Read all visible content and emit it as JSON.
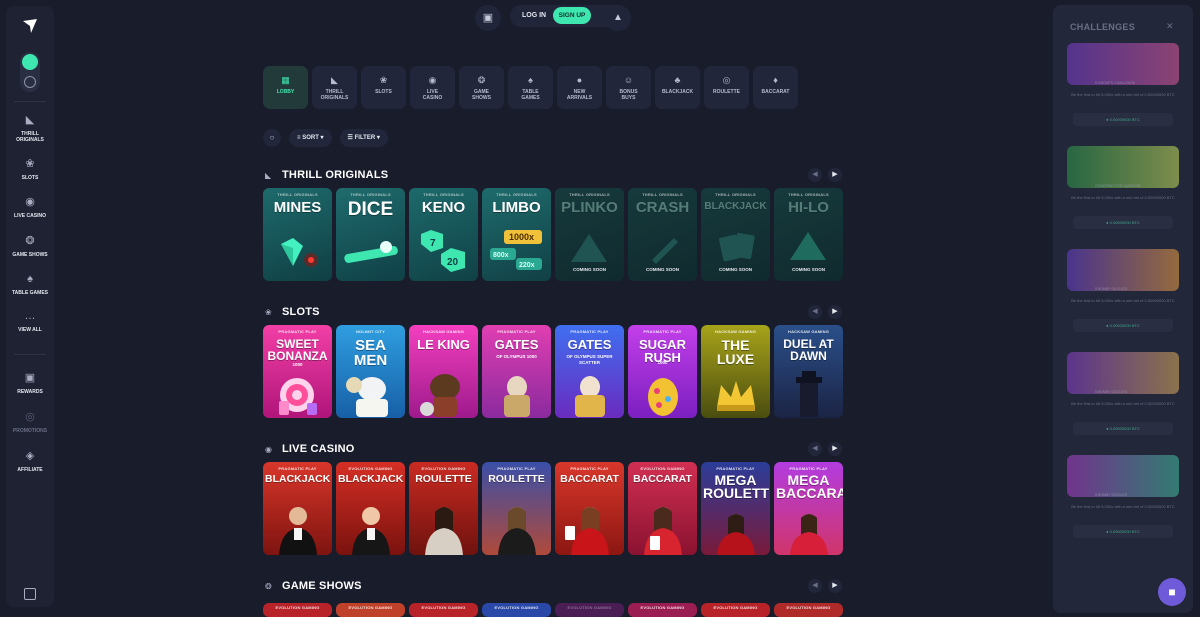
{
  "sidebar": {
    "items": [
      {
        "label": "THRILL ORIGINALS",
        "icon": "thrill-originals-icon"
      },
      {
        "label": "SLOTS",
        "icon": "cherry-icon"
      },
      {
        "label": "LIVE CASINO",
        "icon": "live-icon"
      },
      {
        "label": "GAME SHOWS",
        "icon": "wheel-icon"
      },
      {
        "label": "TABLE GAMES",
        "icon": "cards-icon"
      },
      {
        "label": "VIEW ALL",
        "icon": "dots-icon"
      },
      {
        "label": "REWARDS",
        "icon": "gift-icon"
      },
      {
        "label": "PROMOTIONS",
        "icon": "promotions-icon"
      },
      {
        "label": "AFFILIATE",
        "icon": "affiliate-icon"
      }
    ]
  },
  "topbar": {
    "login": "LOG IN",
    "signup": "SIGN UP"
  },
  "categories": [
    {
      "label": "LOBBY",
      "icon": "grid-icon"
    },
    {
      "label": "THRILL ORIGINALS",
      "icon": "thrill-originals-icon"
    },
    {
      "label": "SLOTS",
      "icon": "cherry-icon"
    },
    {
      "label": "LIVE CASINO",
      "icon": "live-icon"
    },
    {
      "label": "GAME SHOWS",
      "icon": "wheel-icon"
    },
    {
      "label": "TABLE GAMES",
      "icon": "cards-icon"
    },
    {
      "label": "NEW ARRIVALS",
      "icon": "new-icon"
    },
    {
      "label": "BONUS BUYS",
      "icon": "bonus-icon"
    },
    {
      "label": "BLACKJACK",
      "icon": "spade-icon"
    },
    {
      "label": "ROULETTE",
      "icon": "roulette-icon"
    },
    {
      "label": "BACCARAT",
      "icon": "diamond-icon"
    }
  ],
  "tools": {
    "sort": "SORT",
    "filter": "FILTER"
  },
  "sections": {
    "originals": {
      "title": "THRILL ORIGINALS",
      "games": [
        {
          "provider": "THRILL ORIGINALS",
          "name": "MINES",
          "soon": ""
        },
        {
          "provider": "THRILL ORIGINALS",
          "name": "DICE",
          "soon": ""
        },
        {
          "provider": "THRILL ORIGINALS",
          "name": "KENO",
          "soon": "",
          "extra1": "7",
          "extra2": "20"
        },
        {
          "provider": "THRILL ORIGINALS",
          "name": "LIMBO",
          "soon": "",
          "extra1": "1000x",
          "extra2": "800x",
          "extra3": "220x"
        },
        {
          "provider": "THRILL ORIGINALS",
          "name": "PLINKO",
          "soon": "COMING SOON"
        },
        {
          "provider": "THRILL ORIGINALS",
          "name": "CRASH",
          "soon": "COMING SOON"
        },
        {
          "provider": "THRILL ORIGINALS",
          "name": "BLACKJACK",
          "soon": "COMING SOON"
        },
        {
          "provider": "THRILL ORIGINALS",
          "name": "HI-LO",
          "soon": "COMING SOON"
        }
      ]
    },
    "slots": {
      "title": "SLOTS",
      "games": [
        {
          "provider": "PRAGMATIC PLAY",
          "name": "SWEET BONANZA",
          "sub": "1000"
        },
        {
          "provider": "NOLIMIT CITY",
          "name": "SEA MEN",
          "sub": ""
        },
        {
          "provider": "HACKSAW GAMING",
          "name": "LE KING",
          "sub": ""
        },
        {
          "provider": "PRAGMATIC PLAY",
          "name": "GATES",
          "sub": "OF OLYMPUS 1000"
        },
        {
          "provider": "PRAGMATIC PLAY",
          "name": "GATES",
          "sub": "OF OLYMPUS SUPER SCATTER"
        },
        {
          "provider": "PRAGMATIC PLAY",
          "name": "SUGAR RUSH",
          "sub": "1000"
        },
        {
          "provider": "HACKSAW GAMING",
          "name": "THE LUXE",
          "sub": ""
        },
        {
          "provider": "HACKSAW GAMING",
          "name": "DUEL AT DAWN",
          "sub": ""
        }
      ]
    },
    "live": {
      "title": "LIVE CASINO",
      "games": [
        {
          "provider": "PRAGMATIC PLAY",
          "name": "BLACKJACK"
        },
        {
          "provider": "EVOLUTION GAMING",
          "name": "BLACKJACK"
        },
        {
          "provider": "EVOLUTION GAMING",
          "name": "ROULETTE"
        },
        {
          "provider": "PRAGMATIC PLAY",
          "name": "ROULETTE"
        },
        {
          "provider": "PRAGMATIC PLAY",
          "name": "BACCARAT"
        },
        {
          "provider": "EVOLUTION GAMING",
          "name": "BACCARAT"
        },
        {
          "provider": "PRAGMATIC PLAY",
          "name": "MEGA ROULETTE"
        },
        {
          "provider": "PRAGMATIC PLAY",
          "name": "MEGA BACCARAT"
        }
      ]
    },
    "gameshows": {
      "title": "GAME SHOWS",
      "providers": [
        "EVOLUTION GAMING",
        "EVOLUTION GAMING",
        "EVOLUTION GAMING",
        "EVOLUTION GAMING",
        "EVOLUTION GAMING",
        "EVOLUTION GAMING",
        "EVOLUTION GAMING",
        "EVOLUTION GAMING"
      ]
    }
  },
  "challenges": {
    "title": "CHALLENGES",
    "cards": [
      {
        "badge": "5 GROUPS CHALLENGE",
        "text": "Be the first to hit 5,000x with a min bet of 0.00000000 BTC",
        "reward": "0.00000000 BTC"
      },
      {
        "badge": "CONSTRUCTOR CASHOOR",
        "text": "Be the first to hit 5,000x with a min bet of 0.00000000 BTC",
        "reward": "0.00000000 BTC"
      },
      {
        "badge": "5 BOMBY GIGGLES",
        "text": "Be the first to hit 5,000x with a min bet of 0.00000000 BTC",
        "reward": "0.00000000 BTC"
      },
      {
        "badge": "5 BOMBY GIGGLES",
        "text": "Be the first to hit 5,000x with a min bet of 0.00000000 BTC",
        "reward": "0.00000000 BTC"
      },
      {
        "badge": "5 BOMBY GIGGLES",
        "text": "Be the first to hit 5,000x with a min bet of 0.00000000 BTC",
        "reward": "0.00000000 BTC"
      }
    ]
  }
}
